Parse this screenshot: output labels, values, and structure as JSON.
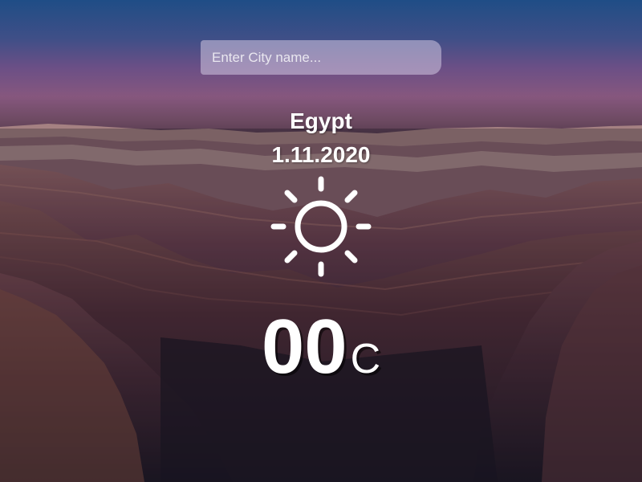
{
  "search": {
    "placeholder": "Enter City name...",
    "value": ""
  },
  "weather": {
    "city": "Egypt",
    "date": "1.11.2020",
    "icon": "sun-icon",
    "temperature": "00",
    "unit": "C"
  },
  "colors": {
    "text": "#ffffff",
    "sky_top": "#1f4d86",
    "sky_horizon": "#86577e",
    "canyon_dark": "#151521"
  }
}
